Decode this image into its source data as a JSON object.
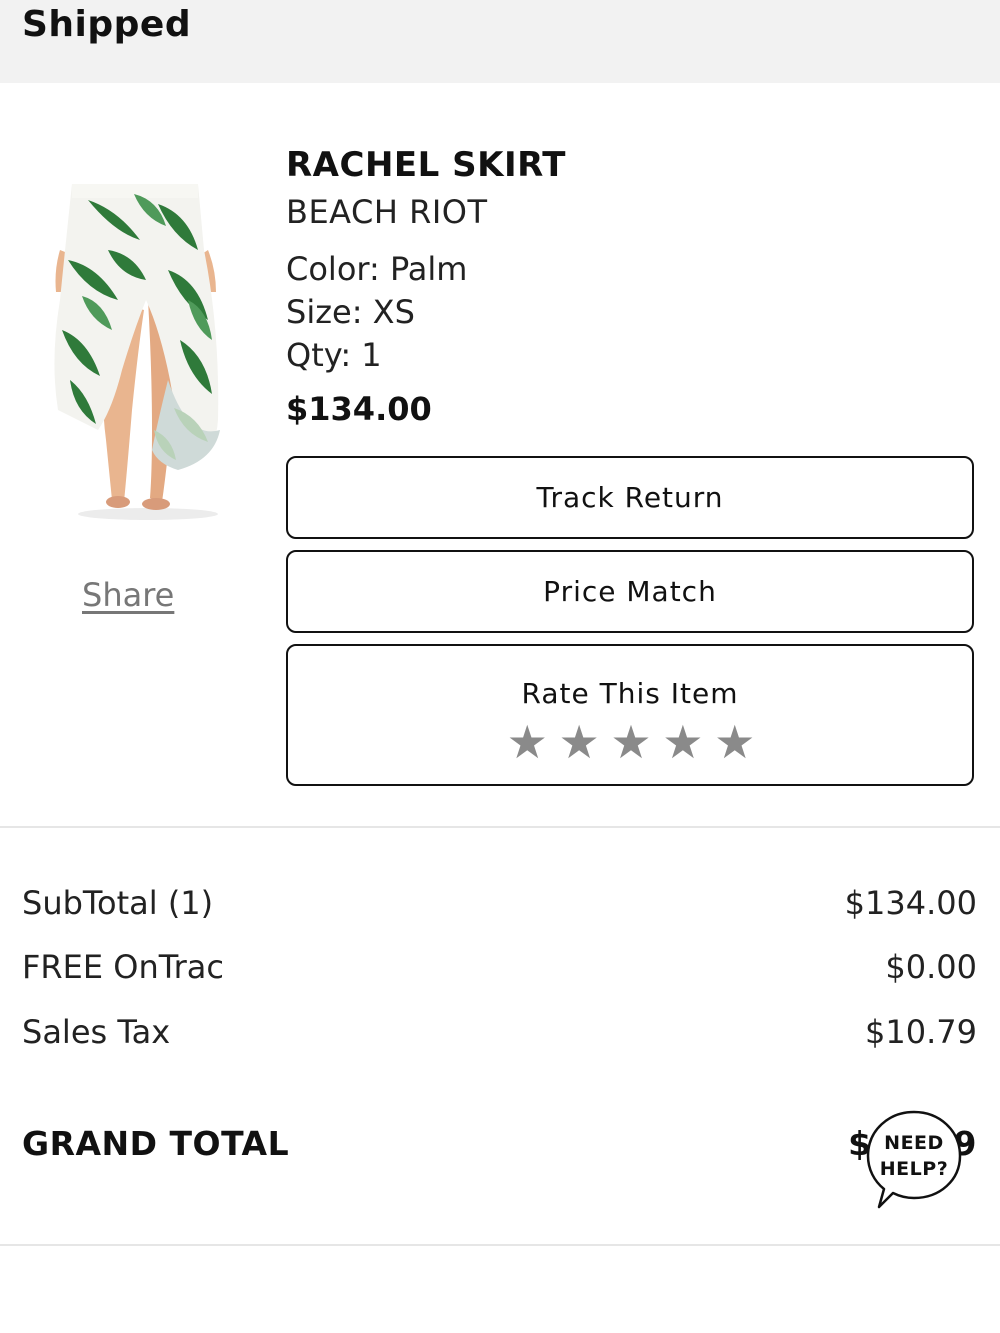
{
  "header": {
    "status": "Shipped"
  },
  "item": {
    "name": "RACHEL SKIRT",
    "brand": "BEACH RIOT",
    "color_line": "Color: Palm",
    "size_line": "Size: XS",
    "qty_line": "Qty: 1",
    "price": "$134.00",
    "image_icon": "skirt-product-photo",
    "share_label": "Share"
  },
  "actions": {
    "track_return": "Track Return",
    "price_match": "Price Match",
    "rate_label": "Rate This Item",
    "rating": {
      "value": 0,
      "max": 5,
      "star_glyph": "★",
      "empty_color": "#8a8a8a"
    }
  },
  "totals": {
    "subtotal_label": "SubTotal (1)",
    "subtotal_value": "$134.00",
    "shipping_label": "FREE OnTrac",
    "shipping_value": "$0.00",
    "tax_label": "Sales Tax",
    "tax_value": "$10.79",
    "grand_label": "GRAND TOTAL",
    "grand_value_visible": "$",
    "grand_value_tail": "9"
  },
  "help": {
    "line1": "NEED",
    "line2": "HELP?",
    "icon": "speech-bubble-icon"
  },
  "colors": {
    "header_bg": "#f2f2f2",
    "text": "#111111",
    "star": "#8a8a8a",
    "share_link": "#777777",
    "leaf_green": "#2f7a3a"
  }
}
